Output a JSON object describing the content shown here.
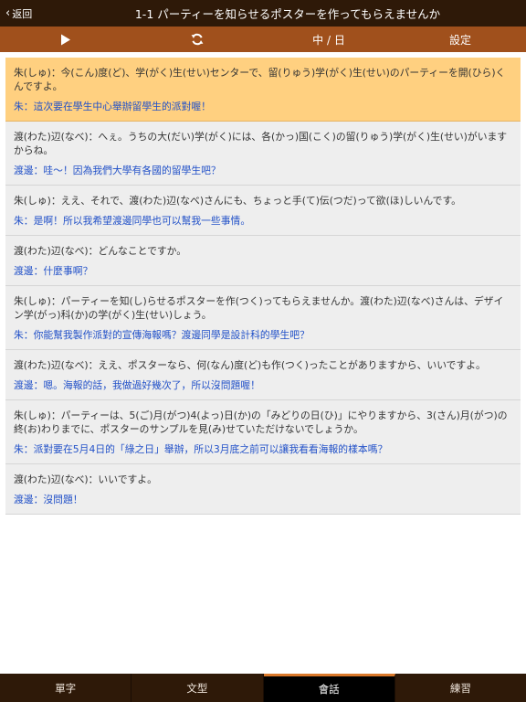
{
  "header": {
    "back_label": "返回",
    "title": "1-1 パーティーを知らせるポスターを作ってもらえませんか"
  },
  "toolbar": {
    "play_icon": "play-icon",
    "repeat_icon": "repeat-icon",
    "language_label": "中 / 日",
    "settings_label": "設定"
  },
  "dialogue": [
    {
      "jp": "朱(しゅ)：今(こん)度(ど)、学(がく)生(せい)センターで、留(りゅう)学(がく)生(せい)のパーティーを開(ひら)くんですよ。",
      "zh": "朱：這次要在學生中心舉辦留學生的派對喔！",
      "active": true
    },
    {
      "jp": "渡(わた)辺(なべ)：へぇ。うちの大(だい)学(がく)には、各(かっ)国(こく)の留(りゅう)学(がく)生(せい)がいますからね。",
      "zh": "渡邊：哇～！因為我們大學有各國的留學生吧？",
      "active": false
    },
    {
      "jp": "朱(しゅ)：ええ、それで、渡(わた)辺(なべ)さんにも、ちょっと手(て)伝(つだ)って欲(ほ)しいんです。",
      "zh": "朱：是啊！所以我希望渡邊同學也可以幫我一些事情。",
      "active": false
    },
    {
      "jp": "渡(わた)辺(なべ)：どんなことですか。",
      "zh": "渡邊：什麼事啊？",
      "active": false
    },
    {
      "jp": "朱(しゅ)：パーティーを知(し)らせるポスターを作(つく)ってもらえませんか。渡(わた)辺(なべ)さんは、デザイン学(がっ)科(か)の学(がく)生(せい)しょう。",
      "zh": "朱：你能幫我製作派對的宣傳海報嗎？渡邊同學是設計科的學生吧？",
      "active": false
    },
    {
      "jp": "渡(わた)辺(なべ)：ええ、ポスターなら、何(なん)度(ど)も作(つく)ったことがありますから、いいですよ。",
      "zh": "渡邊：嗯。海報的話，我做過好幾次了，所以沒問題喔！",
      "active": false
    },
    {
      "jp": "朱(しゅ)：パーティーは、5(ご)月(がつ)4(よっ)日(か)の「みどりの日(ひ)」にやりますから、3(さん)月(がつ)の終(お)わりまでに、ポスターのサンプルを見(み)せていただけないでしょうか。",
      "zh": "朱：派對要在5月4日的「綠之日」舉辦，所以3月底之前可以讓我看看海報的樣本嗎？",
      "active": false
    },
    {
      "jp": "渡(わた)辺(なべ)：いいですよ。",
      "zh": "渡邊：沒問題！",
      "active": false
    }
  ],
  "tabs": [
    {
      "label": "單字",
      "selected": false
    },
    {
      "label": "文型",
      "selected": false
    },
    {
      "label": "會話",
      "selected": true
    },
    {
      "label": "練習",
      "selected": false
    }
  ],
  "colors": {
    "titlebar": "#2e1908",
    "toolbar": "#a0501c",
    "active_entry": "#ffd080",
    "translation_text": "#2251c8",
    "tab_accent": "#d9782a"
  }
}
